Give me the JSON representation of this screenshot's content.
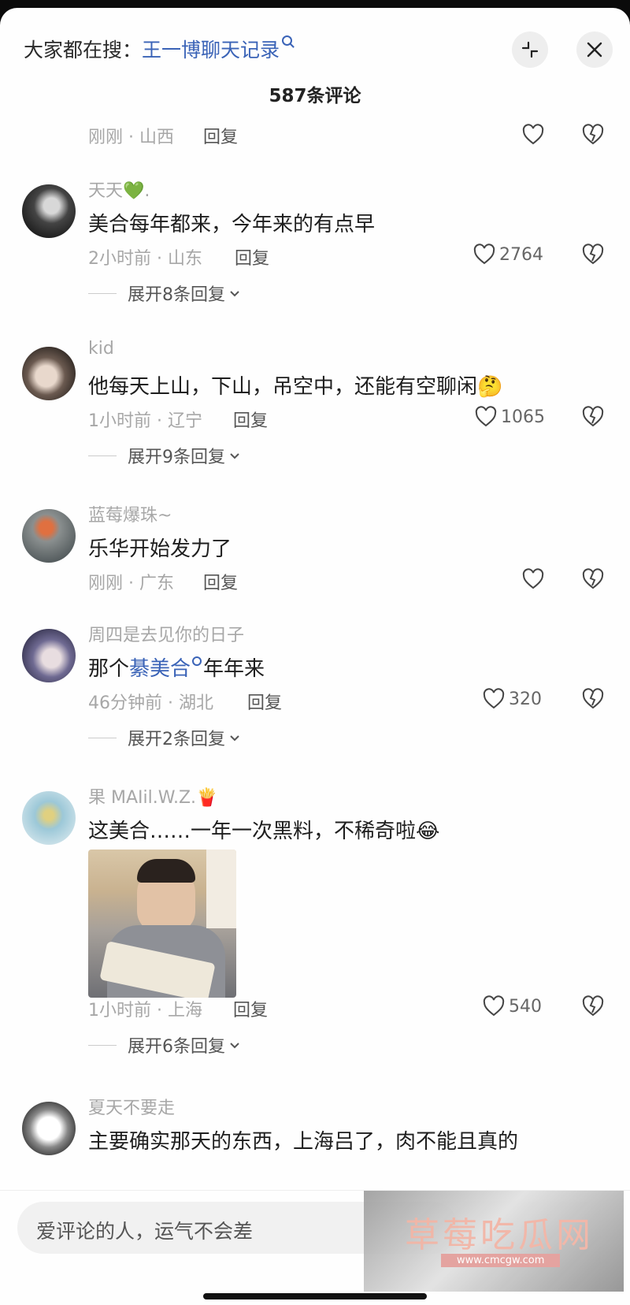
{
  "header": {
    "search_prefix": "大家都在搜：",
    "search_keyword": "王一博聊天记录",
    "comment_count": "587条评论"
  },
  "comments": [
    {
      "meta": "刚刚 · 山西",
      "reply": "回复",
      "likes": ""
    },
    {
      "name": "天天💚.",
      "text": "美合每年都来，今年来的有点早",
      "meta": "2小时前 · 山东",
      "reply": "回复",
      "likes": "2764",
      "expand": "展开8条回复"
    },
    {
      "name": "kid",
      "text": "他每天上山，下山，吊空中，还能有空聊闲🤔",
      "meta": "1小时前 · 辽宁",
      "reply": "回复",
      "likes": "1065",
      "expand": "展开9条回复"
    },
    {
      "name": "蓝莓爆珠~",
      "text": "乐华开始发力了",
      "meta": "刚刚 · 广东",
      "reply": "回复",
      "likes": ""
    },
    {
      "name": "周四是去见你的日子",
      "text_pre": "那个",
      "text_kw": "綦美合",
      "text_post": "年年来",
      "meta": "46分钟前 · 湖北",
      "reply": "回复",
      "likes": "320",
      "expand": "展开2条回复"
    },
    {
      "name": "果 MAIil.W.Z.🍟",
      "text": "这美合……一年一次黑料，不稀奇啦😂",
      "meta": "1小时前 · 上海",
      "reply": "回复",
      "likes": "540",
      "expand": "展开6条回复"
    },
    {
      "name": "夏天不要走",
      "text": "主要确实那天的东西，上海吕了，肉不能且真的"
    }
  ],
  "input": {
    "placeholder": "爱评论的人，运气不会差"
  },
  "watermark": {
    "title": "草莓吃瓜网",
    "url": "www.cmcgw.com"
  }
}
